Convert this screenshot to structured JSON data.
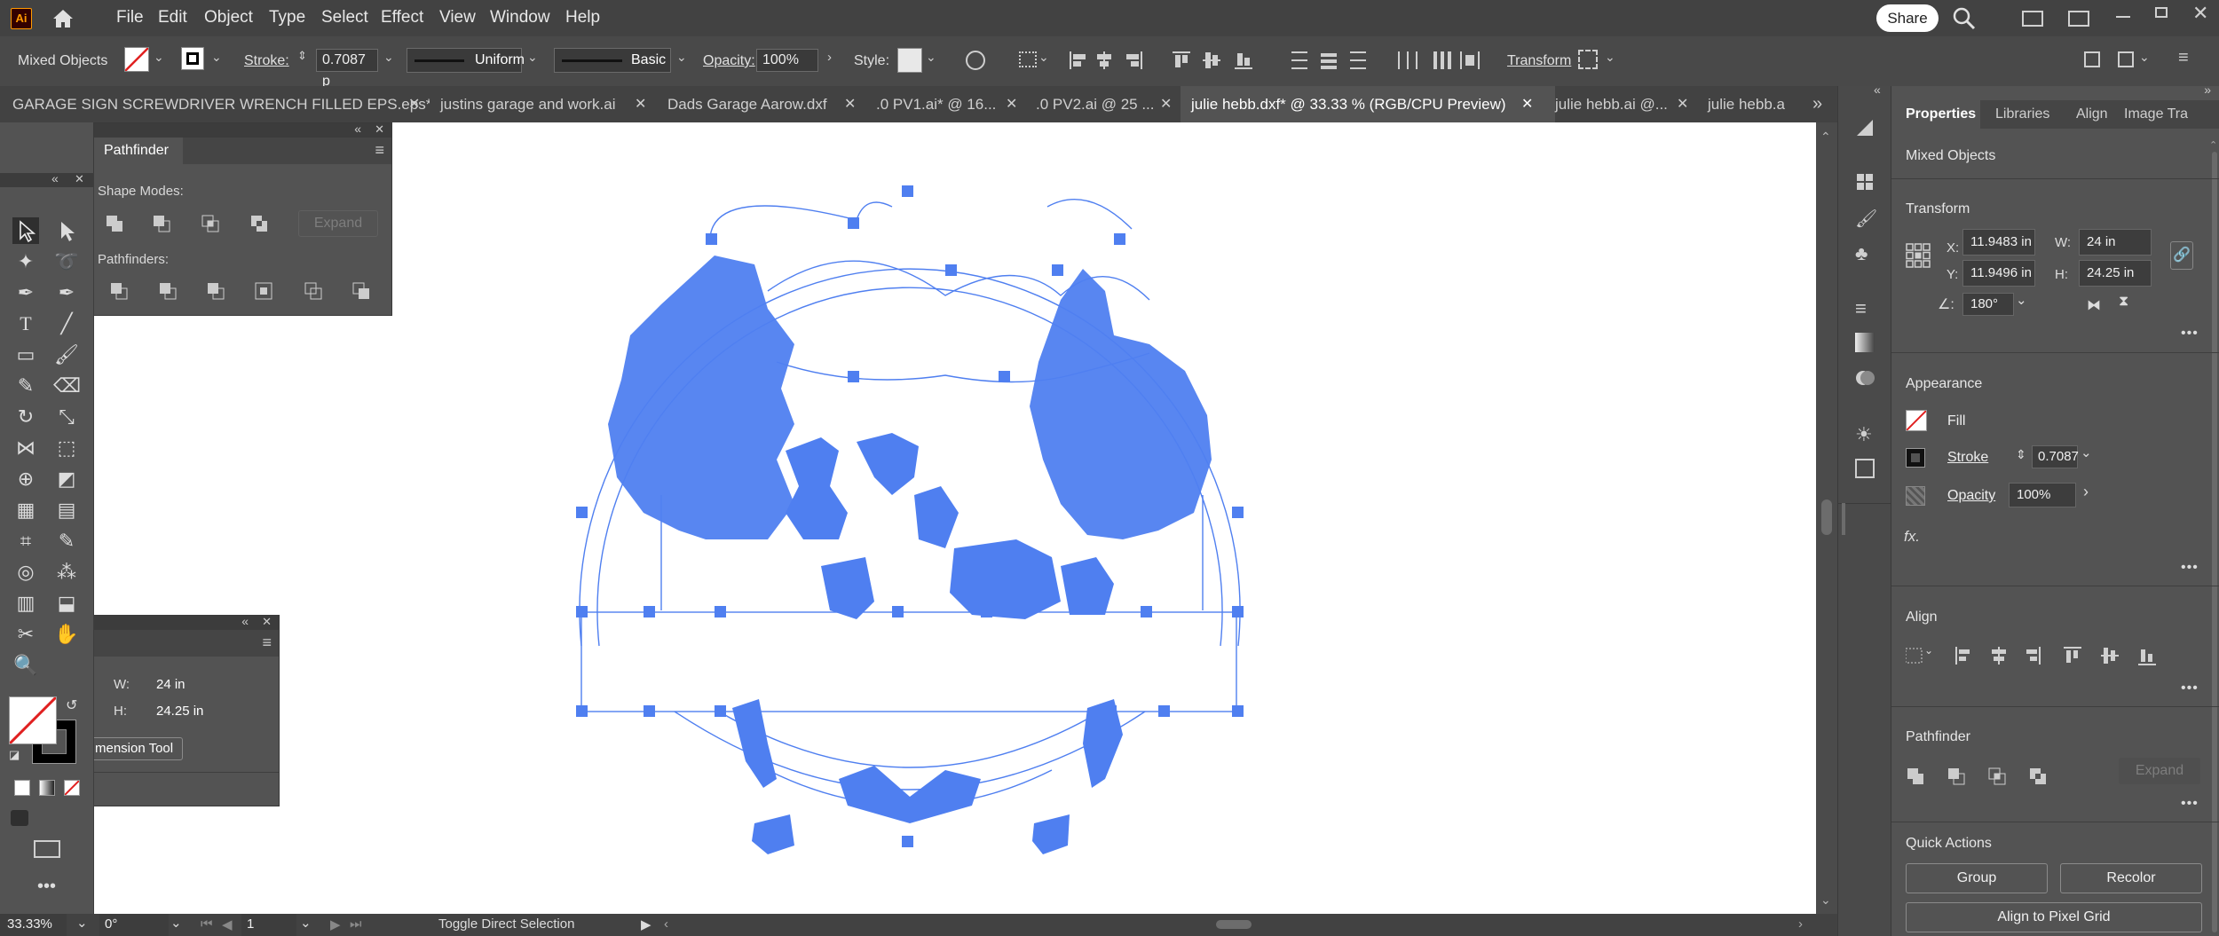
{
  "app": {
    "logo": "Ai"
  },
  "menu": [
    "File",
    "Edit",
    "Object",
    "Type",
    "Select",
    "Effect",
    "View",
    "Window",
    "Help"
  ],
  "header": {
    "share_label": "Share"
  },
  "control": {
    "selection_label": "Mixed Objects",
    "stroke_label": "Stroke:",
    "stroke_value": "0.7087 p",
    "uniform_label": "Uniform",
    "basic_label": "Basic",
    "opacity_label": "Opacity:",
    "opacity_value": "100%",
    "style_label": "Style:",
    "transform_label": "Transform"
  },
  "tabs": [
    {
      "label": "GARAGE SIGN SCREWDRIVER WRENCH FILLED EPS.eps*"
    },
    {
      "label": "justins garage and work.ai"
    },
    {
      "label": "Dads Garage Aarow.dxf"
    },
    {
      "label": ".0 PV1.ai* @ 16..."
    },
    {
      "label": ".0 PV2.ai @ 25 ..."
    },
    {
      "label": "julie hebb.dxf* @ 33.33 % (RGB/CPU Preview)"
    },
    {
      "label": "julie hebb.ai @..."
    },
    {
      "label": "julie hebb.a"
    }
  ],
  "pathfinder_float": {
    "title": "Pathfinder",
    "shape_modes": "Shape Modes:",
    "expand": "Expand",
    "pathfinders": "Pathfinders:"
  },
  "dimension_panel": {
    "w_label": "W:",
    "w_value": "24 in",
    "h_label": "H:",
    "h_value": "24.25 in",
    "tool_label": "mension Tool"
  },
  "properties": {
    "tabs": [
      "Properties",
      "Libraries",
      "Align",
      "Image Tra"
    ],
    "selection": "Mixed Objects",
    "transform_title": "Transform",
    "x_label": "X:",
    "x_value": "11.9483 in",
    "y_label": "Y:",
    "y_value": "11.9496 in",
    "w_label": "W:",
    "w_value": "24 in",
    "h_label": "H:",
    "h_value": "24.25 in",
    "angle_value": "180°",
    "appearance_title": "Appearance",
    "fill_label": "Fill",
    "stroke_label": "Stroke",
    "stroke_value": "0.7087",
    "opacity_label": "Opacity",
    "opacity_value": "100%",
    "fx_label": "fx.",
    "align_title": "Align",
    "pathfinder_title": "Pathfinder",
    "expand_label": "Expand",
    "quick_actions_title": "Quick Actions",
    "group_label": "Group",
    "recolor_label": "Recolor",
    "align_pixel_label": "Align to Pixel Grid"
  },
  "status": {
    "zoom": "33.33%",
    "rotation": "0°",
    "artboard": "1",
    "tool": "Toggle Direct Selection"
  },
  "colors": {
    "accent": "#4f7ff0",
    "ui_dark": "#424242",
    "ui_mid": "#535353"
  }
}
